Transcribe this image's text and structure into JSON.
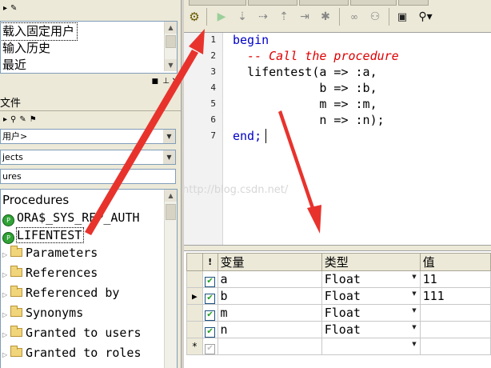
{
  "history": {
    "items": [
      "载入固定用户",
      "输入历史",
      "最近"
    ]
  },
  "browser": {
    "user_combo": "用户>",
    "objects_combo": "jects",
    "filter_value": "ures"
  },
  "tree": {
    "root": "Procedures",
    "nodes": [
      {
        "label": "ORA$_SYS_REP_AUTH",
        "icon": "procedure-icon"
      },
      {
        "label": "LIFENTEST",
        "icon": "procedure-icon"
      }
    ],
    "children": [
      "Parameters",
      "References",
      "Referenced by",
      "Synonyms",
      "Granted to users",
      "Granted to roles"
    ]
  },
  "left_panel_label": "文件",
  "editor": {
    "line_numbers": [
      "1",
      "2",
      "3",
      "4",
      "5",
      "6",
      "7"
    ],
    "lines": {
      "l1_kw": "begin",
      "l2_comment": "  -- Call the procedure",
      "l3": "  lifentest(a => :a,",
      "l4": "            b => :b,",
      "l5": "            m => :m,",
      "l6": "            n => :n);",
      "l7_kw": "end;"
    }
  },
  "watermark": "http://blog.csdn.net/",
  "params_grid": {
    "headers": {
      "flag": "!",
      "variable": "变量",
      "type": "类型",
      "value": "值"
    },
    "rows": [
      {
        "marker": "",
        "checked": true,
        "variable": "a",
        "type": "Float",
        "value": "11"
      },
      {
        "marker": "▶",
        "checked": true,
        "variable": "b",
        "type": "Float",
        "value": "111"
      },
      {
        "marker": "",
        "checked": true,
        "variable": "m",
        "type": "Float",
        "value": ""
      },
      {
        "marker": "",
        "checked": true,
        "variable": "n",
        "type": "Float",
        "value": ""
      }
    ],
    "new_row_marker": "*"
  },
  "colors": {
    "keyword": "#0000c8",
    "comment": "#e00000",
    "annotation_arrow": "#e8332d",
    "check": "#21a121"
  }
}
